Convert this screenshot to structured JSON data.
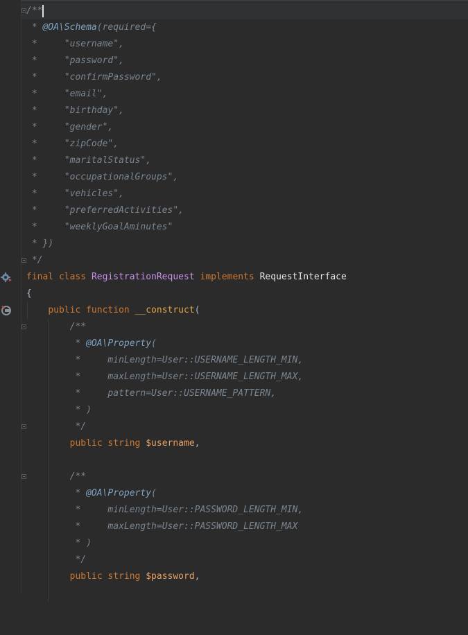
{
  "editor": {
    "lines": [
      {
        "indent": "",
        "text": "/**"
      },
      {
        "indent": "",
        "star": " * ",
        "annotation": "@OA\\Schema",
        "rest": "(required={"
      },
      {
        "indent": "",
        "star": " *     ",
        "rest": "\"username\","
      },
      {
        "indent": "",
        "star": " *     ",
        "rest": "\"password\","
      },
      {
        "indent": "",
        "star": " *     ",
        "rest": "\"confirmPassword\","
      },
      {
        "indent": "",
        "star": " *     ",
        "rest": "\"email\","
      },
      {
        "indent": "",
        "star": " *     ",
        "rest": "\"birthday\","
      },
      {
        "indent": "",
        "star": " *     ",
        "rest": "\"gender\","
      },
      {
        "indent": "",
        "star": " *     ",
        "rest": "\"zipCode\","
      },
      {
        "indent": "",
        "star": " *     ",
        "rest": "\"maritalStatus\","
      },
      {
        "indent": "",
        "star": " *     ",
        "rest": "\"occupationalGroups\","
      },
      {
        "indent": "",
        "star": " *     ",
        "rest": "\"vehicles\","
      },
      {
        "indent": "",
        "star": " *     ",
        "rest": "\"preferredActivities\","
      },
      {
        "indent": "",
        "star": " *     ",
        "rest": "\"weeklyGoalAminutes\""
      },
      {
        "indent": "",
        "star": " * ",
        "rest": "})"
      },
      {
        "indent": "",
        "star": " */",
        "rest": ""
      }
    ],
    "class_decl": {
      "kw1": "final",
      "kw2": "class",
      "name": "RegistrationRequest",
      "kw3": "implements",
      "iface": "RequestInterface"
    },
    "open_brace": "{",
    "ctor": {
      "kw1": "public",
      "kw2": "function",
      "name": "__construct",
      "paren": "("
    },
    "prop1": {
      "doc_open": "/**",
      "ann_star": " * ",
      "ann": "@OA\\Property",
      "ann_paren": "(",
      "args": [
        "minLength=User::USERNAME_LENGTH_MIN,",
        "maxLength=User::USERNAME_LENGTH_MAX,",
        "pattern=User::USERNAME_PATTERN,"
      ],
      "close_paren": " * )",
      "doc_close": " */",
      "kw1": "public",
      "type": "string",
      "var": "$username",
      "tail": ","
    },
    "prop2": {
      "doc_open": "/**",
      "ann_star": " * ",
      "ann": "@OA\\Property",
      "ann_paren": "(",
      "args": [
        "minLength=User::PASSWORD_LENGTH_MIN,",
        "maxLength=User::PASSWORD_LENGTH_MAX"
      ],
      "close_paren": " * )",
      "doc_close": " */",
      "kw1": "public",
      "type": "string",
      "var": "$password",
      "tail": ","
    },
    "arg_star": " *     ",
    "space": " "
  },
  "colors": {
    "background": "#2b2b2b",
    "comment": "#7a8590",
    "annotation": "#7fa2c2",
    "keyword": "#cc7832",
    "class_name": "#c792ea",
    "function_name": "#e0a34a",
    "variable": "#e9a063",
    "text": "#a9b7c6"
  },
  "gutter_icons": {
    "class_marker": "gear-icon",
    "constructor_marker": "override-plug-icon"
  }
}
